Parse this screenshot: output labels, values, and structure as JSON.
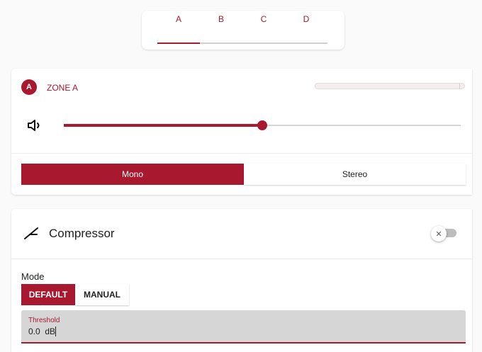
{
  "tabs": {
    "items": [
      {
        "label": "A",
        "selected": true
      },
      {
        "label": "B",
        "selected": false
      },
      {
        "label": "C",
        "selected": false
      },
      {
        "label": "D",
        "selected": false
      }
    ]
  },
  "zone": {
    "badge": "A",
    "title": "ZONE A",
    "level_meter_fraction": 0.0,
    "volume_icon": "speaker-icon",
    "volume_fraction": 0.5,
    "output_mode": {
      "options": [
        "Mono",
        "Stereo"
      ],
      "selected": "Mono"
    }
  },
  "compressor": {
    "icon": "compressor-icon",
    "title": "Compressor",
    "enabled": false,
    "toggle_glyph": "✕",
    "mode_label": "Mode",
    "mode_options": [
      "DEFAULT",
      "MANUAL"
    ],
    "mode_selected": "DEFAULT",
    "threshold": {
      "label": "Threshold",
      "value": "0.0  dB"
    }
  },
  "colors": {
    "accent": "#a8182e",
    "track": "#d5d5d5",
    "field_bg": "#d6d6d6"
  }
}
